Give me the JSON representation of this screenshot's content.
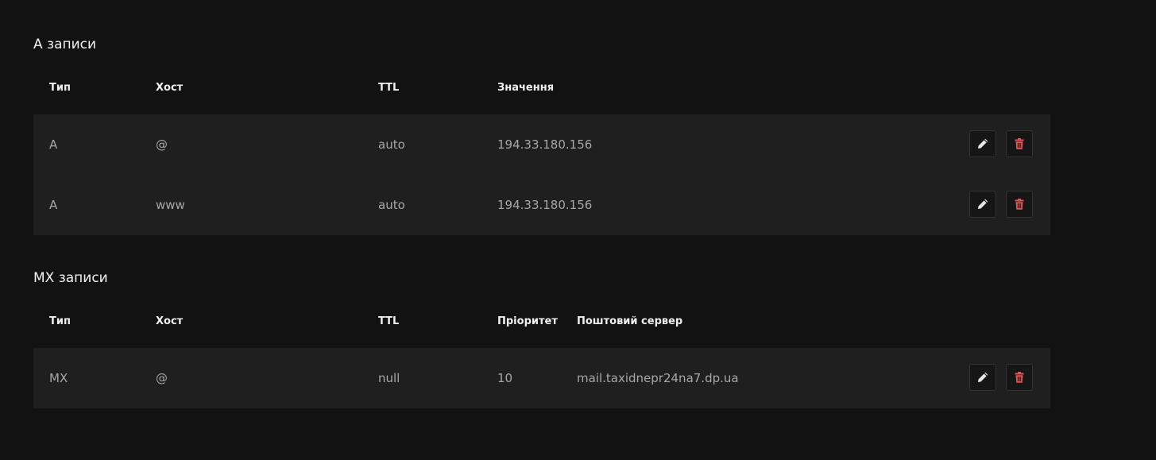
{
  "a_records": {
    "title": "A записи",
    "columns": [
      "Тип",
      "Хост",
      "TTL",
      "Значення"
    ],
    "rows": [
      {
        "type": "A",
        "host": "@",
        "ttl": "auto",
        "value": "194.33.180.156"
      },
      {
        "type": "A",
        "host": "www",
        "ttl": "auto",
        "value": "194.33.180.156"
      }
    ]
  },
  "mx_records": {
    "title": "MX записи",
    "columns": [
      "Тип",
      "Хост",
      "TTL",
      "Пріоритет",
      "Поштовий сервер"
    ],
    "rows": [
      {
        "type": "MX",
        "host": "@",
        "ttl": "null",
        "priority": "10",
        "server": "mail.taxidnepr24na7.dp.ua"
      }
    ]
  },
  "icons": {
    "edit": "pencil-icon",
    "delete": "trash-icon"
  },
  "colors": {
    "background": "#121212",
    "row": "#1f1f1f",
    "delete_icon": "#e05555"
  }
}
